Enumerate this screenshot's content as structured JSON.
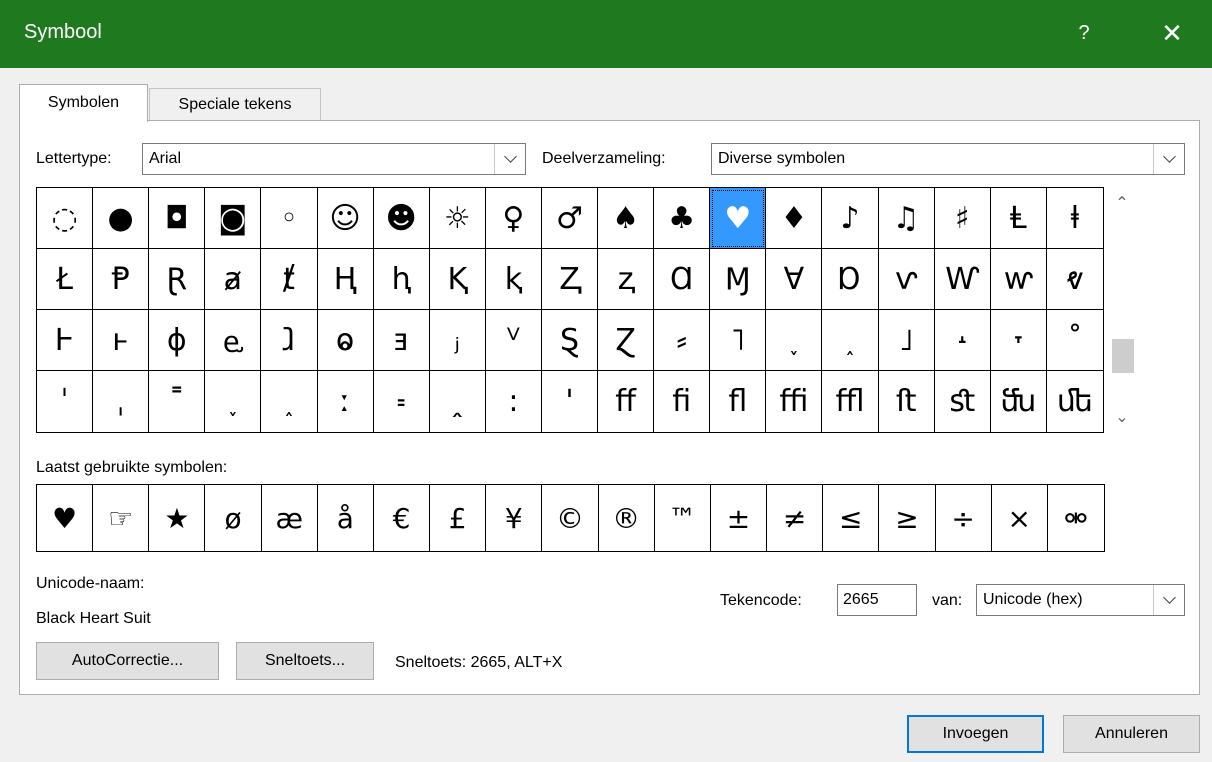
{
  "window": {
    "title": "Symbool",
    "help": "?",
    "close": "✕"
  },
  "tabs": [
    {
      "label": "Symbolen",
      "active": true
    },
    {
      "label": "Speciale tekens",
      "active": false
    }
  ],
  "font": {
    "label": "Lettertype:",
    "value": "Arial"
  },
  "subset": {
    "label": "Deelverzameling:",
    "value": "Diverse symbolen"
  },
  "symbol_grid": [
    [
      "◌",
      "●",
      "◘",
      "◙",
      "◦",
      "☺",
      "☻",
      "☼",
      "♀",
      "♂",
      "♠",
      "♣",
      "♥",
      "♦",
      "♪",
      "♫",
      "♯",
      "Ⱡ",
      "ⱡ"
    ],
    [
      "Ł",
      "Ᵽ",
      "Ɽ",
      "ⱥ",
      "ⱦ",
      "Ⱨ",
      "ⱨ",
      "Ⱪ",
      "ⱪ",
      "Ⱬ",
      "ⱬ",
      "Ɑ",
      "Ɱ",
      "Ɐ",
      "Ɒ",
      "ⱱ",
      "Ⱳ",
      "ⱳ",
      "ⱴ"
    ],
    [
      "Ⱶ",
      "ⱶ",
      "ɸ",
      "ⱸ",
      "ⱹ",
      "ⱺ",
      "ⱻ",
      "ⱼ",
      "ⱽ",
      "Ȿ",
      "Ɀ",
      "⸗",
      "˥",
      "˯",
      "˰",
      "˩",
      "˔",
      "˕",
      "˚"
    ],
    [
      "ˈ",
      "ˌ",
      "˭",
      "˯",
      "˰",
      "ː",
      "꞊",
      "ꞈ",
      "꞉",
      "ꞌ",
      "ﬀ",
      "ﬁ",
      "ﬂ",
      "ﬃ",
      "ﬄ",
      "ﬅ",
      "ﬆ",
      "ﬓ",
      "ﬔ"
    ]
  ],
  "selected_symbol": "♥",
  "recent": {
    "label": "Laatst gebruikte symbolen:",
    "symbols": [
      "♥",
      "☞",
      "★",
      "ø",
      "æ",
      "å",
      "€",
      "£",
      "¥",
      "©",
      "®",
      "™",
      "±",
      "≠",
      "≤",
      "≥",
      "÷",
      "×",
      "⚮"
    ]
  },
  "unicode_name": {
    "label": "Unicode-naam:",
    "value": "Black Heart Suit"
  },
  "char_code": {
    "label": "Tekencode:",
    "value": "2665"
  },
  "from": {
    "label": "van:",
    "value": "Unicode (hex)"
  },
  "buttons": {
    "autocorrect": "AutoCorrectie...",
    "shortcut_key": "Sneltoets...",
    "insert": "Invoegen",
    "cancel": "Annuleren"
  },
  "shortcut_text": "Sneltoets: 2665, ALT+X"
}
